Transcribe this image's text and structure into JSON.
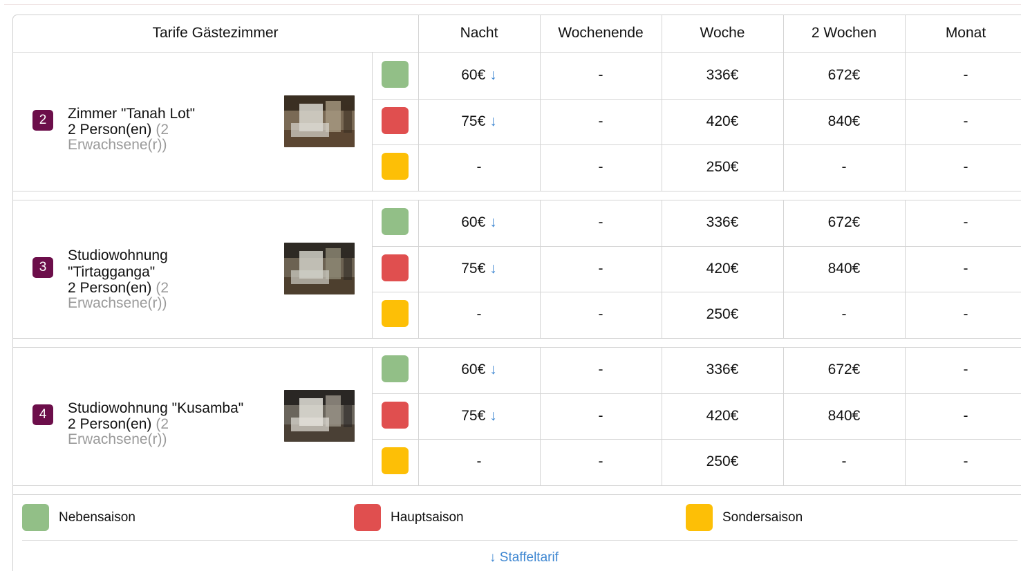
{
  "table": {
    "header": {
      "title": "Tarife Gästezimmer",
      "columns": [
        "Nacht",
        "Wochenende",
        "Woche",
        "2 Wochen",
        "Monat"
      ]
    },
    "rooms": [
      {
        "number": "2",
        "name": "Zimmer \"Tanah Lot\"",
        "name_lines": [
          "Zimmer \"Tanah Lot\""
        ],
        "persons": "2 Person(en)",
        "persons_extra_1": "(2",
        "persons_extra_2": "Erwachsene(r))",
        "rates": [
          {
            "season": "green",
            "cells": [
              "60€",
              "-",
              "336€",
              "672€",
              "-"
            ],
            "staffel": true
          },
          {
            "season": "red",
            "cells": [
              "75€",
              "-",
              "420€",
              "840€",
              "-"
            ],
            "staffel": true
          },
          {
            "season": "yellow",
            "cells": [
              "-",
              "-",
              "250€",
              "-",
              "-"
            ],
            "staffel": false
          }
        ]
      },
      {
        "number": "3",
        "name": "Studiowohnung \"Tirtagganga\"",
        "name_lines": [
          "Studiowohnung",
          "\"Tirtagganga\""
        ],
        "persons": "2 Person(en)",
        "persons_extra_1": "(2",
        "persons_extra_2": "Erwachsene(r))",
        "rates": [
          {
            "season": "green",
            "cells": [
              "60€",
              "-",
              "336€",
              "672€",
              "-"
            ],
            "staffel": true
          },
          {
            "season": "red",
            "cells": [
              "75€",
              "-",
              "420€",
              "840€",
              "-"
            ],
            "staffel": true
          },
          {
            "season": "yellow",
            "cells": [
              "-",
              "-",
              "250€",
              "-",
              "-"
            ],
            "staffel": false
          }
        ]
      },
      {
        "number": "4",
        "name": "Studiowohnung \"Kusamba\"",
        "name_lines": [
          "Studiowohnung \"Kusamba\""
        ],
        "persons": "2 Person(en)",
        "persons_extra_1": "(2",
        "persons_extra_2": "Erwachsene(r))",
        "rates": [
          {
            "season": "green",
            "cells": [
              "60€",
              "-",
              "336€",
              "672€",
              "-"
            ],
            "staffel": true
          },
          {
            "season": "red",
            "cells": [
              "75€",
              "-",
              "420€",
              "840€",
              "-"
            ],
            "staffel": true
          },
          {
            "season": "yellow",
            "cells": [
              "-",
              "-",
              "250€",
              "-",
              "-"
            ],
            "staffel": false
          }
        ]
      }
    ],
    "staffel_arrow": "↓"
  },
  "legend": [
    {
      "season": "green",
      "label": "Nebensaison"
    },
    {
      "season": "red",
      "label": "Hauptsaison"
    },
    {
      "season": "yellow",
      "label": "Sondersaison"
    }
  ],
  "footer": {
    "staffel_link": "↓ Staffeltarif"
  },
  "colors": {
    "green": "#92bf87",
    "red": "#e04f4f",
    "yellow": "#fdbf06",
    "badge": "#6c0e4a",
    "link": "#3d86d1",
    "border": "#d4d4d4"
  }
}
